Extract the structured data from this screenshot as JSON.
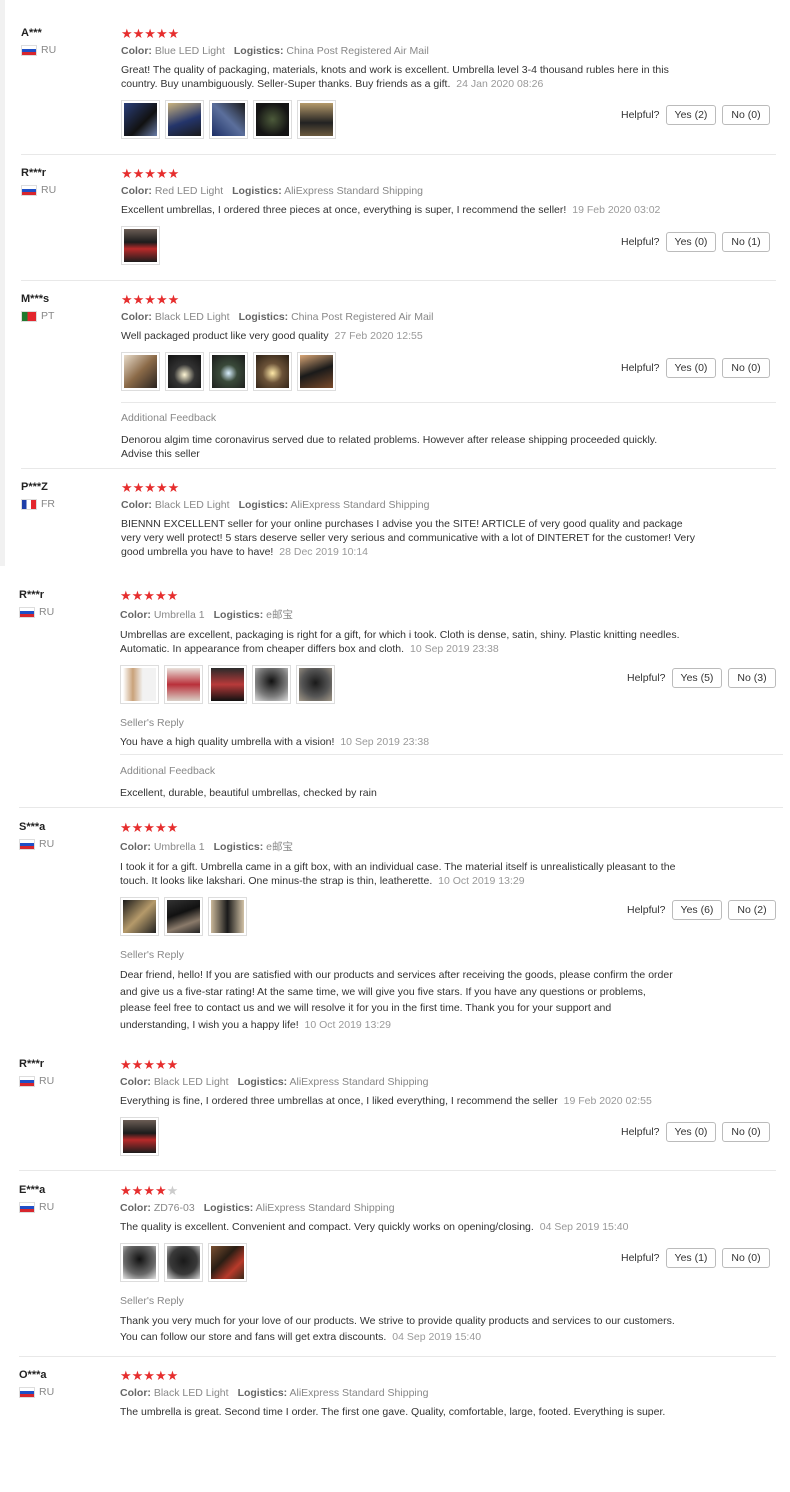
{
  "labels": {
    "color": "Color:",
    "logistics": "Logistics:",
    "helpful": "Helpful?",
    "seller_reply": "Seller's Reply",
    "additional": "Additional Feedback"
  },
  "reviews": [
    {
      "user": "A***",
      "country": "RU",
      "stars": 5,
      "color": "Blue LED Light",
      "logistics": "China Post Registered Air Mail",
      "text": "Great! The quality of packaging, materials, knots and work is excellent. Umbrella level 3-4 thousand rubles here in this country. Buy unambiguously. Seller-Super thanks. Buy friends as a gift.",
      "date": "24 Jan 2020 08:26",
      "yes": "Yes (2)",
      "no": "No (0)"
    },
    {
      "user": "R***r",
      "country": "RU",
      "stars": 5,
      "color": "Red LED Light",
      "logistics": "AliExpress Standard Shipping",
      "text": "Excellent umbrellas, I ordered three pieces at once, everything is super, I recommend the seller!",
      "date": "19 Feb 2020 03:02",
      "yes": "Yes (0)",
      "no": "No (1)"
    },
    {
      "user": "M***s",
      "country": "PT",
      "stars": 5,
      "color": "Black LED Light",
      "logistics": "China Post Registered Air Mail",
      "text": "Well packaged product like very good quality",
      "date": "27 Feb 2020 12:55",
      "yes": "Yes (0)",
      "no": "No (0)",
      "additional": "Denorou algim time coronavirus served due to related problems. However after release shipping proceeded quickly. Advise this seller"
    },
    {
      "user": "P***Z",
      "country": "FR",
      "stars": 5,
      "color": "Black LED Light",
      "logistics": "AliExpress Standard Shipping",
      "text": "BIENNN EXCELLENT seller for your online purchases I advise you the SITE! ARTICLE of very good quality and package very very well protect! 5 stars deserve seller very serious and communicative with a lot of DINTERET for the customer! Very good umbrella you have to have!",
      "date": "28 Dec 2019 10:14"
    },
    {
      "user": "R***r",
      "country": "RU",
      "stars": 5,
      "color": "Umbrella 1",
      "logistics": "e邮宝",
      "text": "Umbrellas are excellent, packaging is right for a gift, for which i took. Cloth is dense, satin, shiny. Plastic knitting needles. Automatic. In appearance from cheaper differs box and cloth.",
      "date": "10 Sep 2019 23:38",
      "yes": "Yes (5)",
      "no": "No (3)",
      "reply": "You have a high quality umbrella with a vision!",
      "reply_date": "10 Sep 2019 23:38",
      "additional": "Excellent, durable, beautiful umbrellas, checked by rain"
    },
    {
      "user": "S***a",
      "country": "RU",
      "stars": 5,
      "color": "Umbrella 1",
      "logistics": "e邮宝",
      "text": "I took it for a gift. Umbrella came in a gift box, with an individual case. The material itself is unrealistically pleasant to the touch. It looks like lakshari. One minus-the strap is thin, leatherette.",
      "date": "10 Oct 2019 13:29",
      "yes": "Yes (6)",
      "no": "No (2)",
      "reply": "Dear friend, hello! If you are satisfied with our products and services after receiving the goods, please confirm the order and give us a five-star rating! At the same time, we will give you five stars. If you have any questions or problems, please feel free to contact us and we will resolve it for you in the first time. Thank you for your support and understanding, I wish you a happy life!",
      "reply_date": "10 Oct 2019 13:29"
    },
    {
      "user": "R***r",
      "country": "RU",
      "stars": 5,
      "color": "Black LED Light",
      "logistics": "AliExpress Standard Shipping",
      "text": "Everything is fine, I ordered three umbrellas at once, I liked everything, I recommend the seller",
      "date": "19 Feb 2020 02:55",
      "yes": "Yes (0)",
      "no": "No (0)"
    },
    {
      "user": "E***a",
      "country": "RU",
      "stars": 4,
      "color": "ZD76-03",
      "logistics": "AliExpress Standard Shipping",
      "text": "The quality is excellent. Convenient and compact. Very quickly works on opening/closing.",
      "date": "04 Sep 2019 15:40",
      "yes": "Yes (1)",
      "no": "No (0)",
      "reply": "Thank you very much for your love of our products. We strive to provide quality products and services to our customers. You can follow our store and fans will get extra discounts.",
      "reply_date": "04 Sep 2019 15:40"
    },
    {
      "user": "O***a",
      "country": "RU",
      "stars": 5,
      "color": "Black LED Light",
      "logistics": "AliExpress Standard Shipping",
      "text": "The umbrella is great. Second time I order. The first one gave. Quality, comfortable, large, footed. Everything is super."
    }
  ]
}
